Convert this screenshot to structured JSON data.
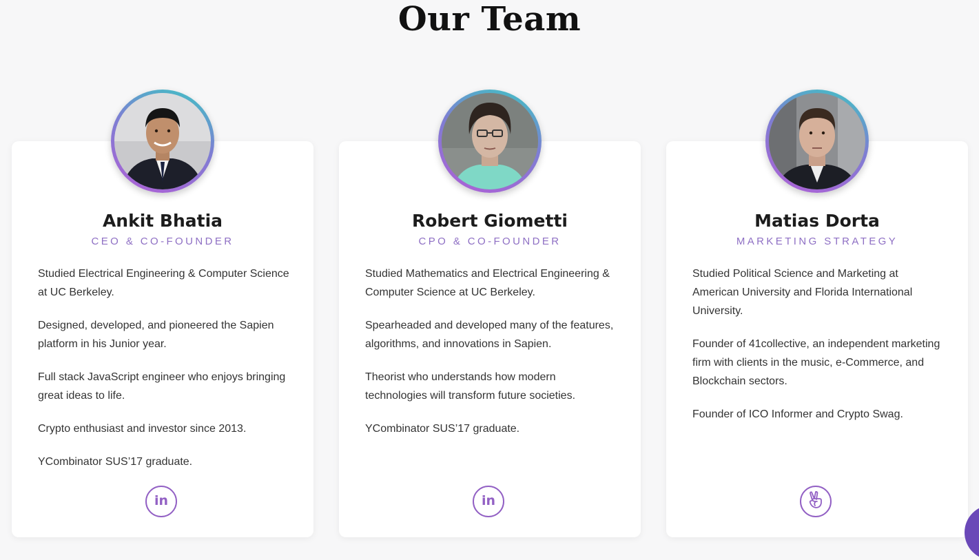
{
  "page": {
    "title": "Our Team"
  },
  "members": [
    {
      "name": "Ankit Bhatia",
      "role": "CEO & CO-FOUNDER",
      "bio": [
        "Studied Electrical Engineering & Computer Science at UC Berkeley.",
        "Designed, developed, and pioneered the Sapien platform in his Junior year.",
        "Full stack JavaScript engineer who enjoys bringing great ideas to life.",
        "Crypto enthusiast and investor since 2013.",
        "YCombinator SUS’17 graduate."
      ],
      "social": {
        "icon": "linkedin-icon",
        "text": "in"
      }
    },
    {
      "name": "Robert Giometti",
      "role": "CPO & CO-FOUNDER",
      "bio": [
        "Studied Mathematics and Electrical Engineering & Computer Science at UC Berkeley.",
        "Spearheaded and developed many of the features, algorithms, and innovations in Sapien.",
        "Theorist who understands how modern technologies will transform future societies.",
        "YCombinator SUS’17 graduate."
      ],
      "social": {
        "icon": "linkedin-icon",
        "text": "in"
      }
    },
    {
      "name": "Matias Dorta",
      "role": "MARKETING STRATEGY",
      "bio": [
        "Studied Political Science and Marketing at American University and Florida International University.",
        "Founder of 41collective, an independent marketing firm with clients in the music, e-Commerce, and Blockchain sectors.",
        "Founder of ICO Informer and Crypto Swag."
      ],
      "social": {
        "icon": "angellist-icon",
        "text": ""
      }
    }
  ],
  "colors": {
    "accent": "#9260c4",
    "role_text": "#8e6fc4",
    "ring_start": "#3dc6c3",
    "ring_end": "#b05ed6",
    "background": "#f7f7f8",
    "card": "#ffffff",
    "chat_bubble": "#6a48b8"
  }
}
